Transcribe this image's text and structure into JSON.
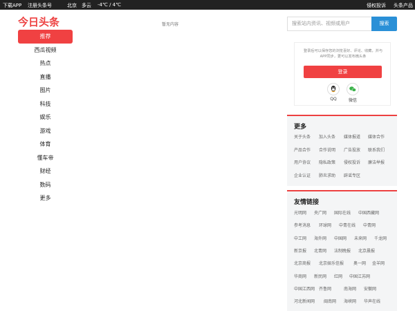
{
  "topbar": {
    "download_app": "下载APP",
    "register": "注册头条号",
    "city": "北京",
    "weather": "多云",
    "temp": "-4℃ / 4℃",
    "complaint": "侵权投诉",
    "products": "头条产品"
  },
  "logo": "今日头条",
  "nav": [
    "推荐",
    "西瓜视频",
    "热点",
    "直播",
    "图片",
    "科技",
    "娱乐",
    "游戏",
    "体育",
    "懂车帝",
    "财经",
    "数码",
    "更多"
  ],
  "empty_tip": "暂无内容",
  "search": {
    "placeholder": "搜索站内资讯、视频或用户",
    "button": "搜索"
  },
  "login": {
    "tip": "登录后可以保存您的浏览喜好、评论、收藏，并与APP同步，更可以发布微头条",
    "button": "登录",
    "qq": "QQ",
    "wechat": "微信"
  },
  "more": {
    "title": "更多",
    "links": [
      "关于头条",
      "加入头条",
      "媒体报道",
      "媒体合作",
      "产品合作",
      "合作说明",
      "广告投放",
      "联系我们",
      "用户协议",
      "隐私政策",
      "侵权投诉",
      "廉洁举报",
      "企业认证",
      "肺炎求助",
      "辟谣专区"
    ]
  },
  "friends": {
    "title": "友情链接",
    "links": [
      "光明网",
      "央广网",
      "国际在线",
      "中国西藏网",
      "参考消息",
      "环球网",
      "中青在线",
      "中青网",
      "中工网",
      "海外网",
      "中国网",
      "未来网",
      "千龙网",
      "新京报",
      "北青网",
      "法制晚报",
      "北京晨报",
      "北京商报",
      "北京娱乐信报",
      "奥一网",
      "金羊网",
      "华商网",
      "新民网",
      "红网",
      "中国江苏网",
      "中国江西网",
      "齐鲁网",
      "南海网",
      "安徽网",
      "河北新闻网",
      "闽南网",
      "海峡网",
      "华声在线"
    ]
  },
  "colors": {
    "brand": "#ed4040",
    "search": "#2a90d7",
    "qq": "#222222",
    "wechat": "#3bb24a"
  }
}
